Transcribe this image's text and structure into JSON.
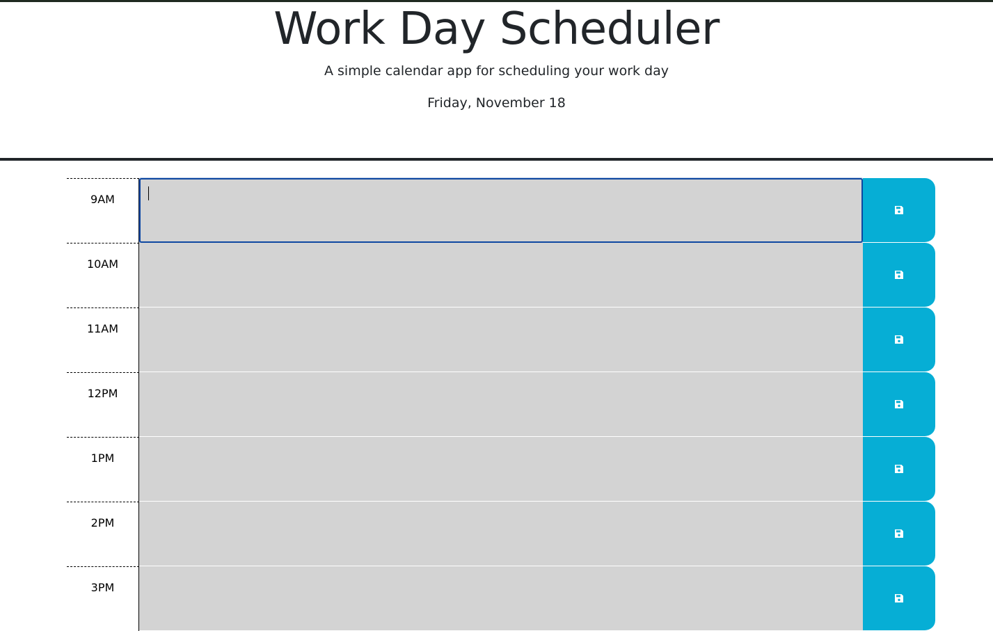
{
  "header": {
    "title": "Work Day Scheduler",
    "lead": "A simple calendar app for scheduling your work day",
    "current_day": "Friday, November 18"
  },
  "colors": {
    "past": "#d3d3d3",
    "save_button": "#06aed5",
    "focus_ring": "#0d47a1"
  },
  "timeblocks": [
    {
      "hour": "9AM",
      "text": "",
      "save_icon": "floppy-disk-icon",
      "focused": true
    },
    {
      "hour": "10AM",
      "text": "",
      "save_icon": "floppy-disk-icon"
    },
    {
      "hour": "11AM",
      "text": "",
      "save_icon": "floppy-disk-icon"
    },
    {
      "hour": "12PM",
      "text": "",
      "save_icon": "floppy-disk-icon"
    },
    {
      "hour": "1PM",
      "text": "",
      "save_icon": "floppy-disk-icon"
    },
    {
      "hour": "2PM",
      "text": "",
      "save_icon": "floppy-disk-icon"
    },
    {
      "hour": "3PM",
      "text": "",
      "save_icon": "floppy-disk-icon"
    }
  ]
}
